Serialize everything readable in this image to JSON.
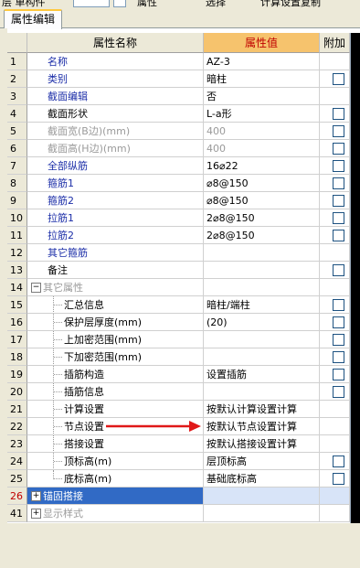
{
  "toolbar": {
    "item1": "层 单构件",
    "item2": "属性",
    "item3": "选择",
    "item4": "计算设置复制"
  },
  "tab": {
    "label": "属性编辑"
  },
  "grid": {
    "headers": {
      "num": "",
      "name": "属性名称",
      "value": "属性值",
      "add": "附加"
    },
    "rows": [
      {
        "num": "1",
        "name": "名称",
        "value": "AZ-3",
        "color": "blue"
      },
      {
        "num": "2",
        "name": "类别",
        "value": "暗柱",
        "color": "blue",
        "checkbox": true
      },
      {
        "num": "3",
        "name": "截面编辑",
        "value": "否",
        "color": "blue"
      },
      {
        "num": "4",
        "name": "截面形状",
        "value": "L-a形",
        "color": "black",
        "checkbox": true
      },
      {
        "num": "5",
        "name": "截面宽(B边)(mm)",
        "value": "400",
        "color": "gray",
        "checkbox": true
      },
      {
        "num": "6",
        "name": "截面高(H边)(mm)",
        "value": "400",
        "color": "gray",
        "checkbox": true
      },
      {
        "num": "7",
        "name": "全部纵筋",
        "value": "16⌀22",
        "color": "blue",
        "checkbox": true
      },
      {
        "num": "8",
        "name": "箍筋1",
        "value": "⌀8@150",
        "color": "blue",
        "checkbox": true
      },
      {
        "num": "9",
        "name": "箍筋2",
        "value": "⌀8@150",
        "color": "blue",
        "checkbox": true
      },
      {
        "num": "10",
        "name": "拉筋1",
        "value": "2⌀8@150",
        "color": "blue",
        "checkbox": true
      },
      {
        "num": "11",
        "name": "拉筋2",
        "value": "2⌀8@150",
        "color": "blue",
        "checkbox": true
      },
      {
        "num": "12",
        "name": "其它箍筋",
        "value": "",
        "color": "blue"
      },
      {
        "num": "13",
        "name": "备注",
        "value": "",
        "color": "black",
        "checkbox": true
      },
      {
        "num": "14",
        "name": "其它属性",
        "value": "",
        "color": "gray",
        "expander": "−"
      },
      {
        "num": "15",
        "name": "汇总信息",
        "value": "暗柱/端柱",
        "color": "black",
        "child": true,
        "checkbox": true
      },
      {
        "num": "16",
        "name": "保护层厚度(mm)",
        "value": "(20)",
        "color": "black",
        "child": true,
        "checkbox": true
      },
      {
        "num": "17",
        "name": "上加密范围(mm)",
        "value": "",
        "color": "black",
        "child": true,
        "checkbox": true
      },
      {
        "num": "18",
        "name": "下加密范围(mm)",
        "value": "",
        "color": "black",
        "child": true,
        "checkbox": true
      },
      {
        "num": "19",
        "name": "插筋构造",
        "value": "设置插筋",
        "color": "black",
        "child": true,
        "checkbox": true
      },
      {
        "num": "20",
        "name": "插筋信息",
        "value": "",
        "color": "black",
        "child": true,
        "checkbox": true
      },
      {
        "num": "21",
        "name": "计算设置",
        "value": "按默认计算设置计算",
        "color": "black",
        "child": true
      },
      {
        "num": "22",
        "name": "节点设置",
        "value": "按默认节点设置计算",
        "color": "black",
        "child": true
      },
      {
        "num": "23",
        "name": "搭接设置",
        "value": "按默认搭接设置计算",
        "color": "black",
        "child": true
      },
      {
        "num": "24",
        "name": "顶标高(m)",
        "value": "层顶标高",
        "color": "black",
        "child": true,
        "checkbox": true
      },
      {
        "num": "25",
        "name": "底标高(m)",
        "value": "基础底标高",
        "color": "black",
        "child": true,
        "checkbox": true,
        "last": true
      },
      {
        "num": "26",
        "name": "锚固搭接",
        "value": "",
        "color": "white",
        "expander": "+",
        "selected": true
      },
      {
        "num": "41",
        "name": "显示样式",
        "value": "",
        "color": "gray",
        "expander": "+"
      }
    ]
  },
  "annotation": {
    "arrow_color": "#e01818"
  }
}
